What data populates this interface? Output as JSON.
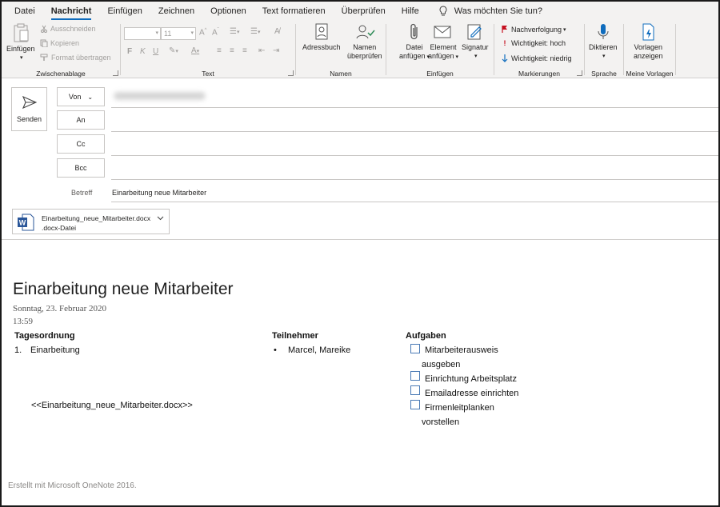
{
  "menu": {
    "tabs": [
      "Datei",
      "Nachricht",
      "Einfügen",
      "Zeichnen",
      "Optionen",
      "Text formatieren",
      "Überprüfen",
      "Hilfe"
    ],
    "active_tab": "Nachricht",
    "tell_me": "Was möchten Sie tun?"
  },
  "ribbon": {
    "clipboard": {
      "paste": "Einfügen",
      "cut": "Ausschneiden",
      "copy": "Kopieren",
      "format_painter": "Format übertragen",
      "label": "Zwischenablage"
    },
    "text": {
      "font_size": "11",
      "bold": "F",
      "italic": "K",
      "underline": "U",
      "label": "Text"
    },
    "names": {
      "address_book": "Adressbuch",
      "check_names_1": "Namen",
      "check_names_2": "überprüfen",
      "label": "Namen"
    },
    "insert": {
      "file_1": "Datei",
      "file_2": "anfügen",
      "item_1": "Element",
      "item_2": "anfügen",
      "signature": "Signatur",
      "label": "Einfügen"
    },
    "tags": {
      "follow_up": "Nachverfolgung",
      "high": "Wichtigkeit: hoch",
      "low": "Wichtigkeit: niedrig",
      "label": "Markierungen"
    },
    "voice": {
      "dictate": "Diktieren",
      "label": "Sprache"
    },
    "templates": {
      "view_1": "Vorlagen",
      "view_2": "anzeigen",
      "label": "Meine Vorlagen"
    }
  },
  "compose": {
    "send": "Senden",
    "from": "Von",
    "to": "An",
    "cc": "Cc",
    "bcc": "Bcc",
    "subject_label": "Betreff",
    "subject": "Einarbeitung neue Mitarbeiter",
    "attachment": {
      "name": "Einarbeitung_neue_Mitarbeiter.docx",
      "type": ".docx-Datei",
      "icon_letter": "W"
    }
  },
  "body": {
    "title": "Einarbeitung neue Mitarbeiter",
    "date": "Sonntag, 23. Februar 2020",
    "time": "13:59",
    "agenda": {
      "header": "Tagesordnung",
      "number": "1.",
      "item": "Einarbeitung"
    },
    "participants": {
      "header": "Teilnehmer",
      "bullet": "•",
      "item": "Marcel, Mareike"
    },
    "tasks": {
      "header": "Aufgaben",
      "t1_a": "Mitarbeiterausweis",
      "t1_b": "ausgeben",
      "t2": "Einrichtung Arbeitsplatz",
      "t3": "Emailadresse einrichten",
      "t4_a": "Firmenleitplanken",
      "t4_b": "vorstellen"
    },
    "attachment_ref": "<<Einarbeitung_neue_Mitarbeiter.docx>>",
    "footer": "Erstellt mit Microsoft OneNote 2016."
  },
  "colors": {
    "accent": "#0f6cbd",
    "flag_red": "#c50f1f",
    "ribbon_bg": "#f3f2f1"
  }
}
